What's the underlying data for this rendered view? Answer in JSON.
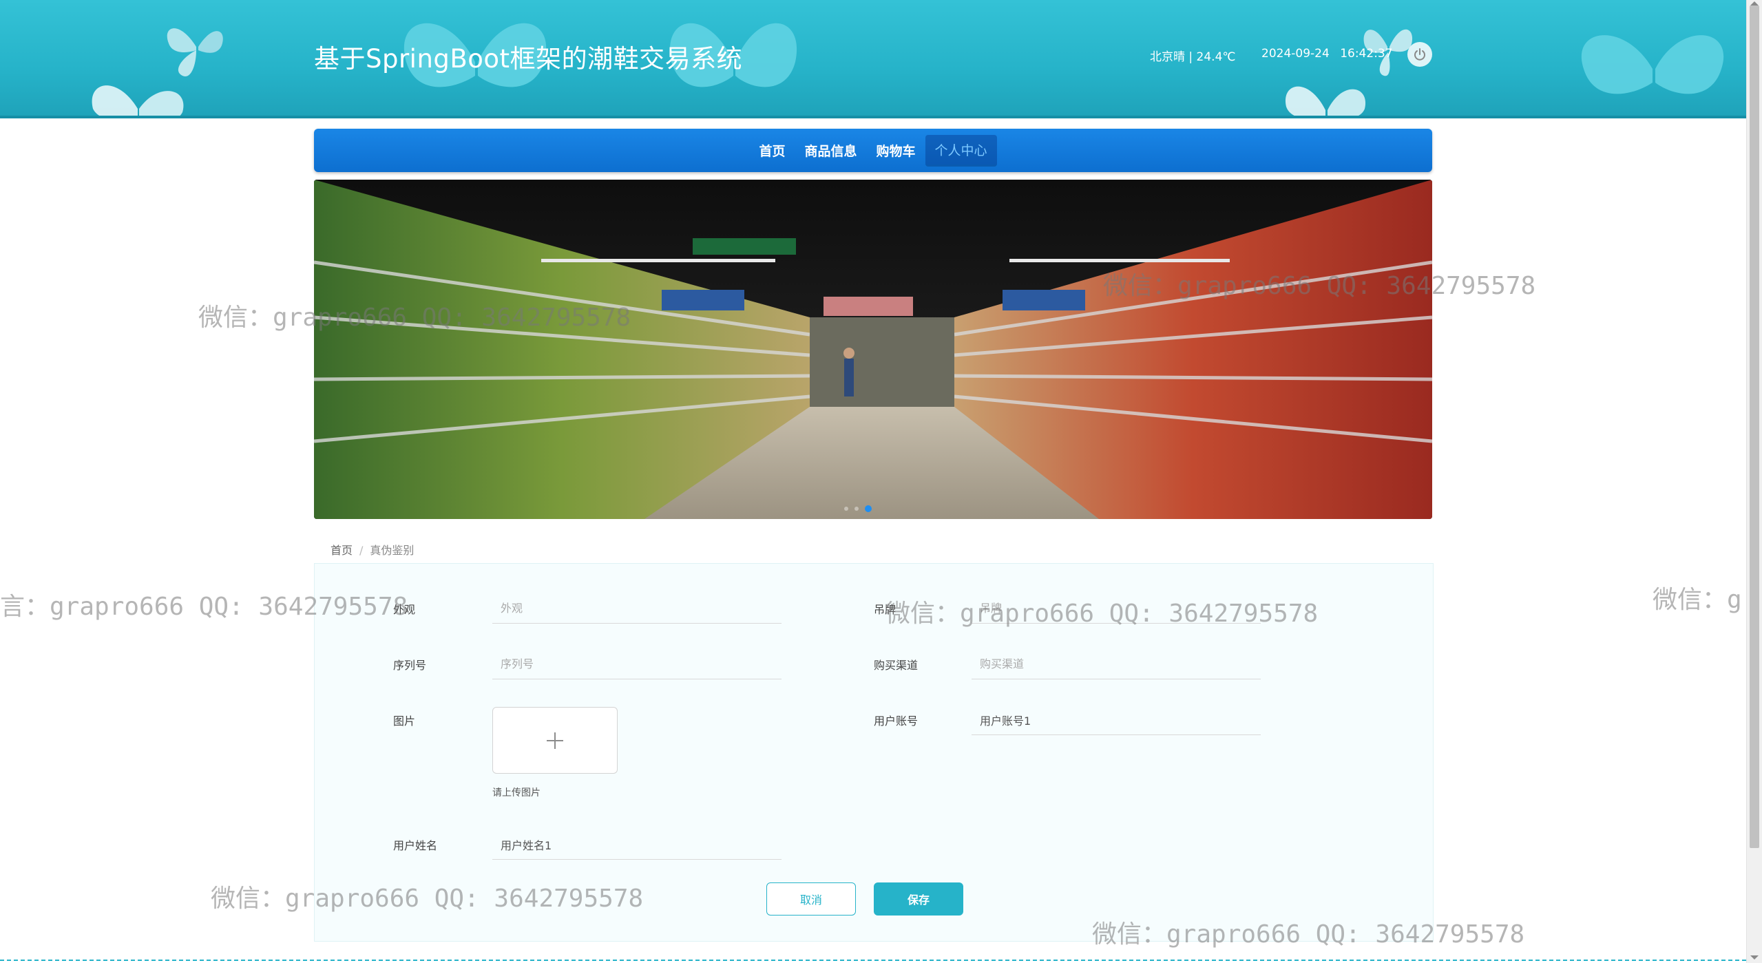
{
  "header": {
    "title": "基于SpringBoot框架的潮鞋交易系统",
    "weather": "北京晴 | 24.4℃",
    "datetime": "2024-09-24  16:42:37"
  },
  "nav": {
    "items": [
      {
        "label": "首页"
      },
      {
        "label": "商品信息"
      },
      {
        "label": "购物车"
      },
      {
        "label": "个人中心",
        "active": true
      }
    ]
  },
  "banner": {
    "slide_count": 3,
    "active_slide": 3
  },
  "breadcrumb": {
    "home": "首页",
    "current": "真伪鉴别"
  },
  "form": {
    "appearance": {
      "label": "外观",
      "placeholder": "外观",
      "value": ""
    },
    "tag": {
      "label": "吊牌",
      "placeholder": "吊牌",
      "value": ""
    },
    "serial": {
      "label": "序列号",
      "placeholder": "序列号",
      "value": ""
    },
    "channel": {
      "label": "购买渠道",
      "placeholder": "购买渠道",
      "value": ""
    },
    "image": {
      "label": "图片",
      "hint": "请上传图片"
    },
    "account": {
      "label": "用户账号",
      "value": "用户账号1"
    },
    "username": {
      "label": "用户姓名",
      "value": "用户姓名1"
    },
    "cancel_label": "取消",
    "save_label": "保存"
  },
  "watermark": {
    "text": "微信：grapro666 QQ: 3642795578",
    "text_cut_right": "微信：gr",
    "text_cut_left": "言：grapro666 QQ: 3642795578"
  },
  "colors": {
    "header": "#26b3c9",
    "nav": "#0d6fd0",
    "accent": "#26b3c9"
  }
}
